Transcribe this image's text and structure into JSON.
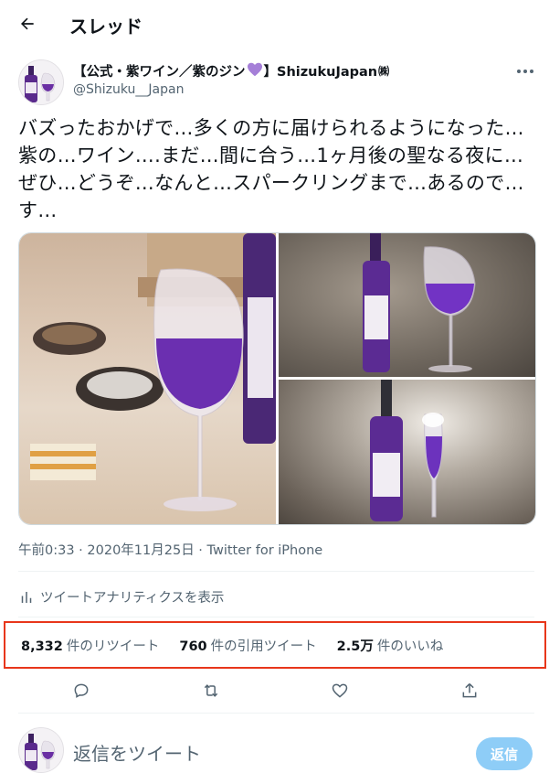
{
  "header": {
    "title": "スレッド",
    "back_icon": "arrow-left-icon"
  },
  "tweet": {
    "author_name_prefix": "【公式・紫ワイン／紫のジン",
    "author_name_suffix": "】ShizukuJapan",
    "author_name_tag": "㈱",
    "handle": "@Shizuku__Japan",
    "text": "バズったおかげで…多くの方に届けられるようになった…紫の…ワイン….まだ…間に合う…1ヶ月後の聖なる夜に…ぜひ…どうぞ…なんと…スパークリングまで…あるので…す…",
    "timestamp": "午前0:33 · 2020年11月25日 · Twitter for iPhone",
    "analytics_label": "ツイートアナリティクスを表示",
    "stats": [
      {
        "value": "8,332",
        "label": "件のリツイート"
      },
      {
        "value": "760",
        "label": "件の引用ツイート"
      },
      {
        "value": "2.5万",
        "label": "件のいいね"
      }
    ],
    "highlight_color": "#e8361a"
  },
  "reply": {
    "placeholder": "返信をツイート",
    "button_label": "返信"
  },
  "colors": {
    "accent": "#1d9bf0",
    "muted": "#536471",
    "wine": "#5a2a8c"
  }
}
